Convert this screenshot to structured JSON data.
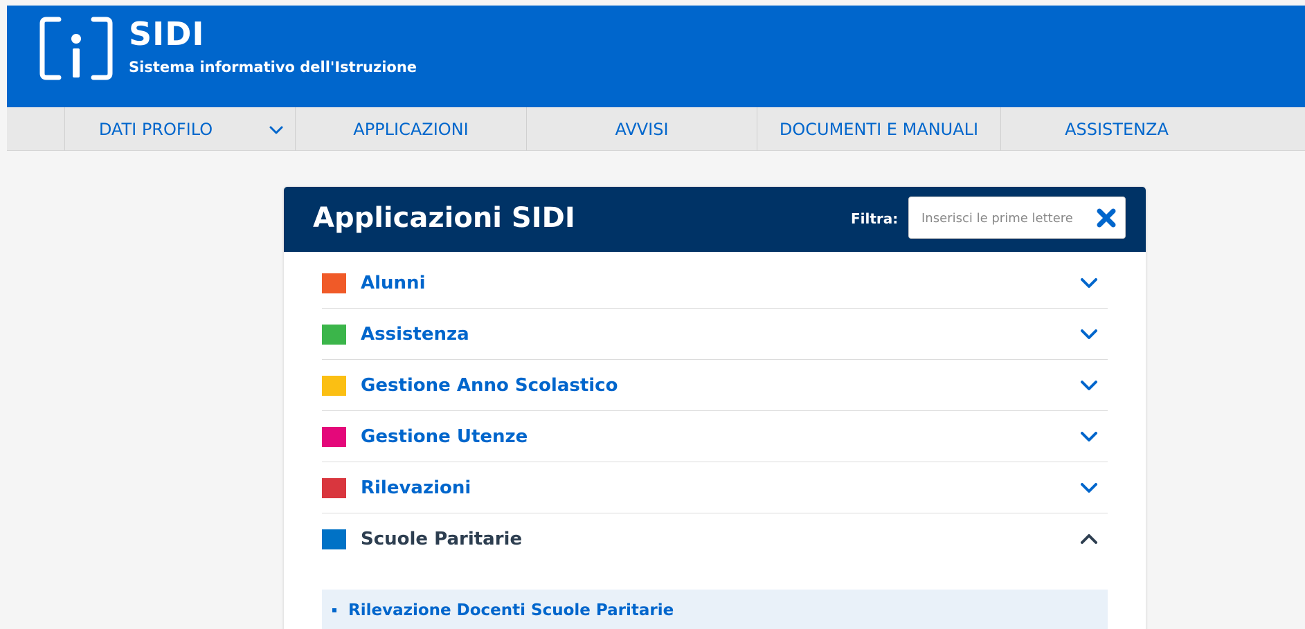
{
  "brand": {
    "title": "SIDI",
    "subtitle": "Sistema informativo dell'Istruzione",
    "primary_color": "#0066cc"
  },
  "nav": {
    "items": [
      {
        "label": "DATI PROFILO",
        "has_dropdown": true
      },
      {
        "label": "APPLICAZIONI"
      },
      {
        "label": "AVVISI"
      },
      {
        "label": "DOCUMENTI E MANUALI"
      },
      {
        "label": "ASSISTENZA"
      }
    ]
  },
  "panel": {
    "title": "Applicazioni SIDI",
    "header_color": "#003366",
    "filter": {
      "label": "Filtra:",
      "value": "",
      "placeholder": "Inserisci le prime lettere",
      "clear_icon": "close-icon"
    },
    "categories": [
      {
        "label": "Alunni",
        "color": "#f05a28",
        "expanded": false
      },
      {
        "label": "Assistenza",
        "color": "#3bb54a",
        "expanded": false
      },
      {
        "label": "Gestione Anno Scolastico",
        "color": "#fbbf13",
        "expanded": false
      },
      {
        "label": "Gestione Utenze",
        "color": "#e4087a",
        "expanded": false
      },
      {
        "label": "Rilevazioni",
        "color": "#d9363e",
        "expanded": false
      },
      {
        "label": "Scuole Paritarie",
        "color": "#0072c6",
        "expanded": true,
        "items": [
          {
            "label": "Rilevazione Docenti Scuole Paritarie"
          }
        ]
      }
    ]
  }
}
